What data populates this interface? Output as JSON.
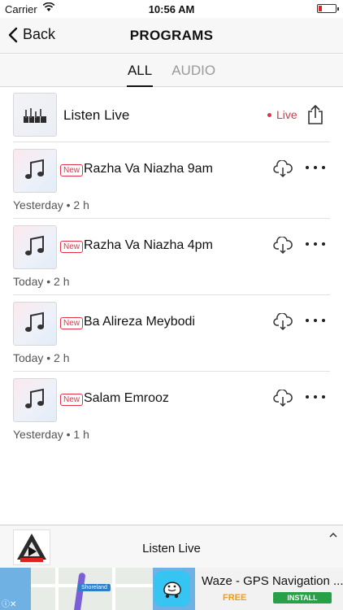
{
  "status_bar": {
    "carrier": "Carrier",
    "time": "10:56 AM"
  },
  "nav": {
    "back_label": "Back",
    "title": "PROGRAMS"
  },
  "tabs": [
    {
      "label": "ALL",
      "active": true
    },
    {
      "label": "AUDIO",
      "active": false
    }
  ],
  "live_row": {
    "label": "Listen Live",
    "status": "Live"
  },
  "episodes": [
    {
      "badge": "New",
      "title": "Razha Va Niazha 9am",
      "meta": "Yesterday • 2 h"
    },
    {
      "badge": "New",
      "title": "Razha Va Niazha 4pm",
      "meta": "Today • 2 h"
    },
    {
      "badge": "New",
      "title": "Ba Alireza Meybodi",
      "meta": "Today • 2 h"
    },
    {
      "badge": "New",
      "title": "Salam Emrooz",
      "meta": "Yesterday • 1 h"
    }
  ],
  "player": {
    "now_playing": "Listen Live"
  },
  "ad": {
    "map_street": "Shoreland",
    "title": "Waze - GPS Navigation ...",
    "price": "FREE",
    "install_label": "INSTALL"
  },
  "colors": {
    "accent_red": "#e0334a",
    "install_green": "#27a047",
    "waze_blue": "#36c4f3"
  },
  "icons": [
    "wifi-icon",
    "battery-icon",
    "back-chevron-icon",
    "music-note-icon",
    "piano-keys-icon",
    "share-icon",
    "download-icon",
    "more-icon",
    "caret-up-icon",
    "info-icon",
    "waze-icon"
  ]
}
